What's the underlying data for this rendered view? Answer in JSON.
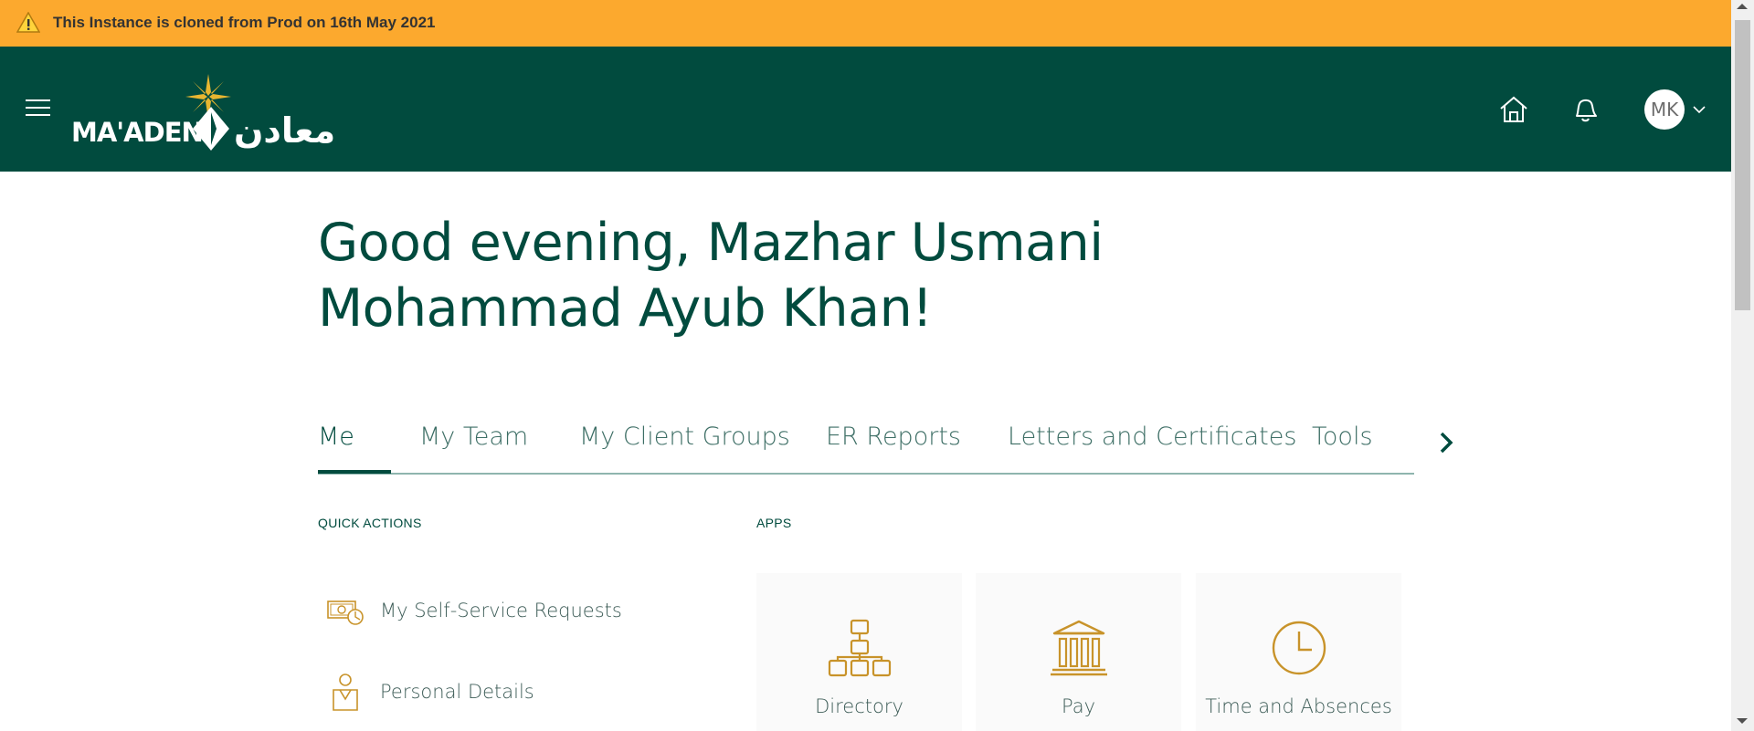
{
  "banner": {
    "message": "This Instance is cloned from Prod on 16th May 2021",
    "color": "#fca92e"
  },
  "header": {
    "background": "#014b3e",
    "logo_text": "MA'ADEN",
    "logo_arabic": "معادن",
    "icons": [
      "menu-icon",
      "home-icon",
      "notifications-icon"
    ],
    "avatar_initials": "MK"
  },
  "greeting": "Good evening, Mazhar Usmani Mohammad Ayub Khan!",
  "tabs": [
    {
      "label": "Me",
      "active": true
    },
    {
      "label": "My Team",
      "active": false
    },
    {
      "label": "My Client Groups",
      "active": false
    },
    {
      "label": "ER Reports",
      "active": false
    },
    {
      "label": "Letters and Certificates",
      "active": false
    },
    {
      "label": "Tools",
      "active": false
    }
  ],
  "quick_actions": {
    "label": "QUICK ACTIONS",
    "items": [
      {
        "label": "My Self-Service Requests",
        "icon": "self-service-requests-icon"
      },
      {
        "label": "Personal Details",
        "icon": "personal-details-icon"
      }
    ]
  },
  "apps": {
    "label": "APPS",
    "items": [
      {
        "label": "Directory",
        "icon": "directory-icon"
      },
      {
        "label": "Pay",
        "icon": "pay-icon"
      },
      {
        "label": "Time and Absences",
        "icon": "time-and-absences-icon"
      }
    ]
  },
  "accent_color": "#c8932a"
}
